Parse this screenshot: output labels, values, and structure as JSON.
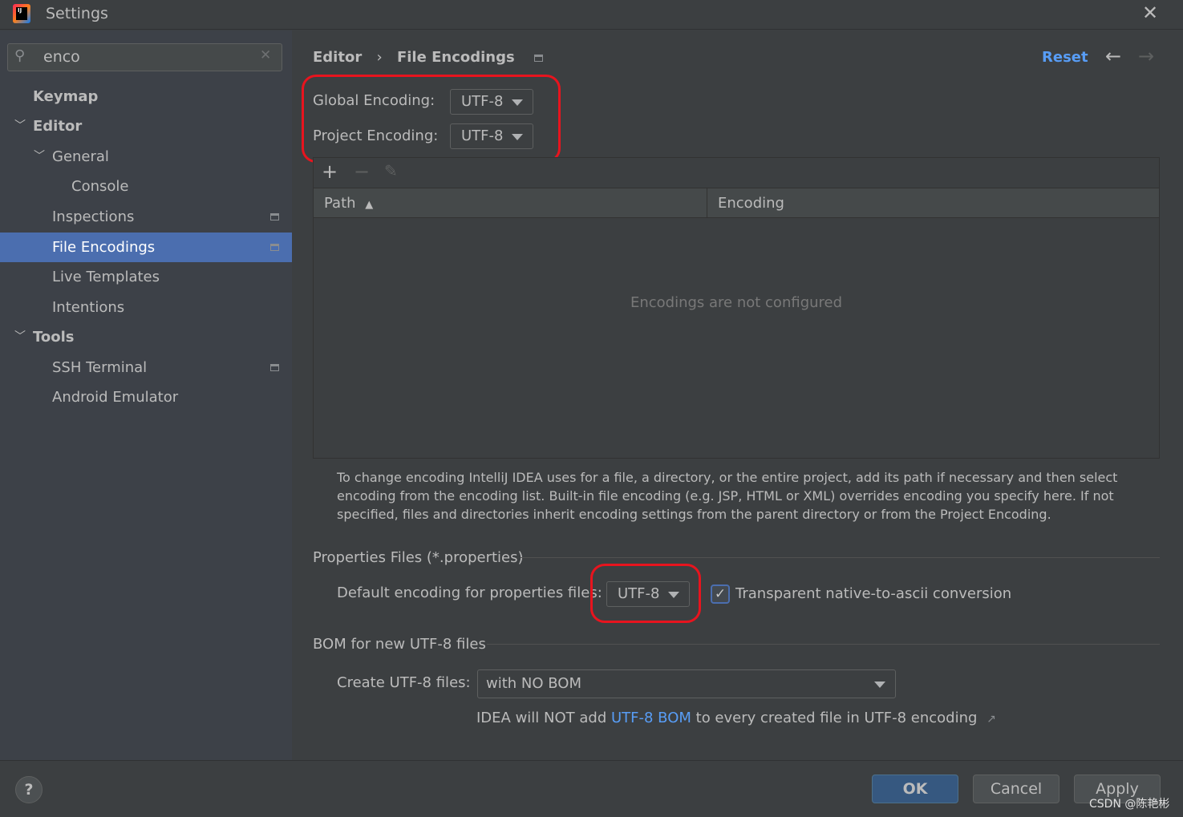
{
  "window": {
    "title": "Settings",
    "close_icon": "close-icon"
  },
  "search": {
    "value": "enco",
    "placeholder": ""
  },
  "sidebar": {
    "items": [
      {
        "label": "Keymap"
      },
      {
        "label": "Editor"
      },
      {
        "label": "General"
      },
      {
        "label": "Console"
      },
      {
        "label": "Inspections"
      },
      {
        "label": "File Encodings"
      },
      {
        "label": "Live Templates"
      },
      {
        "label": "Intentions"
      },
      {
        "label": "Tools"
      },
      {
        "label": "SSH Terminal"
      },
      {
        "label": "Android Emulator"
      }
    ]
  },
  "breadcrumb": {
    "parent": "Editor",
    "current": "File Encodings"
  },
  "header": {
    "reset": "Reset"
  },
  "encoding": {
    "global_label": "Global Encoding:",
    "global_value": "UTF-8",
    "project_label": "Project Encoding:",
    "project_value": "UTF-8"
  },
  "table": {
    "columns": [
      "Path",
      "Encoding"
    ],
    "empty_text": "Encodings are not configured"
  },
  "help_text": "To change encoding IntelliJ IDEA uses for a file, a directory, or the entire project, add its path if necessary and then select encoding from the encoding list. Built-in file encoding (e.g. JSP, HTML or XML) overrides encoding you specify here. If not specified, files and directories inherit encoding settings from the parent directory or from the Project Encoding.",
  "properties": {
    "section": "Properties Files (*.properties)",
    "default_label": "Default encoding for properties files:",
    "default_value": "UTF-8",
    "transparent_label": "Transparent native-to-ascii conversion",
    "transparent_checked": true
  },
  "bom": {
    "section": "BOM for new UTF-8 files",
    "create_label": "Create UTF-8 files:",
    "create_value": "with NO BOM",
    "note_prefix": "IDEA will NOT add ",
    "note_link": "UTF-8 BOM",
    "note_suffix": " to every created file in UTF-8 encoding"
  },
  "footer": {
    "ok": "OK",
    "cancel": "Cancel",
    "apply": "Apply",
    "watermark": "CSDN @陈艳彬"
  },
  "colors": {
    "selection": "#4b6eaf",
    "link": "#589df6",
    "highlight": "#e8141e"
  }
}
